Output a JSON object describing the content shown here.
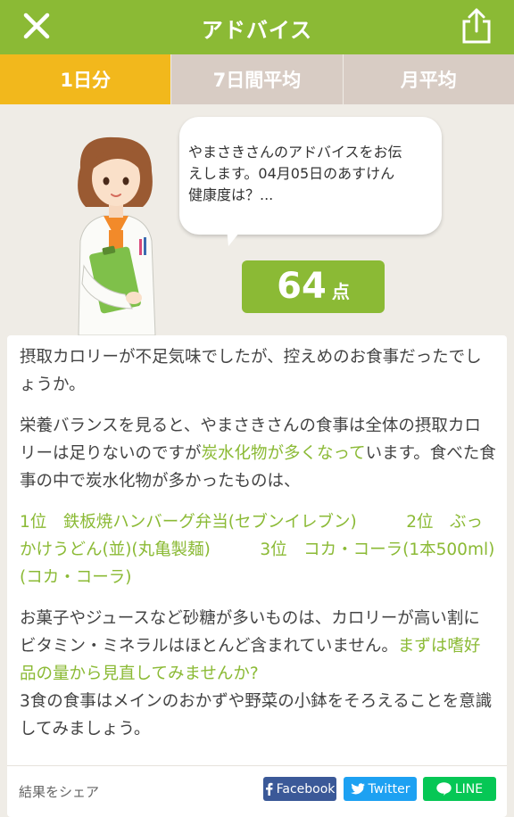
{
  "header": {
    "title": "アドバイス",
    "close_icon": "close-icon",
    "share_icon": "share-icon"
  },
  "tabs": [
    {
      "label": "1日分",
      "active": true
    },
    {
      "label": "7日間平均",
      "active": false
    },
    {
      "label": "月平均",
      "active": false
    }
  ],
  "advisor": {
    "bubble_line1": "やまさきさんのアドバイスをお伝",
    "bubble_line2": "えします。04月05日のあすけん",
    "bubble_line3": "健康度は？...",
    "score_value": "64",
    "score_unit": "点"
  },
  "advice": {
    "para1": "摂取カロリーが不足気味でしたが、控えめのお食事だったでしょうか。",
    "para2_a": "栄養バランスを見ると、やまさきさんの食事は全体の摂取カロリーは足りないのですが",
    "para2_highlight": "炭水化物が多くなって",
    "para2_b": "います。食べた食事の中で炭水化物が多かったものは、",
    "ranking": "1位　鉄板焼ハンバーグ弁当(セブンイレブン)　　　2位　ぶっかけうどん(並)(丸亀製麺)　　　3位　コカ・コーラ(1本500ml)(コカ・コーラ)",
    "para4_a": "お菓子やジュースなど砂糖が多いものは、カロリーが高い割にビタミン・ミネラルはほとんど含まれていません。",
    "para4_highlight": "まずは嗜好品の量から見直してみませんか?",
    "para5": "3食の食事はメインのおかずや野菜の小鉢をそろえることを意識してみましょう。"
  },
  "share": {
    "label": "結果をシェア",
    "facebook": "Facebook",
    "twitter": "Twitter",
    "line": "LINE"
  },
  "colors": {
    "accent": "#8bba35",
    "tab_active": "#f2b81c",
    "tab_inactive": "#d8ccc4",
    "background": "#efece6"
  }
}
